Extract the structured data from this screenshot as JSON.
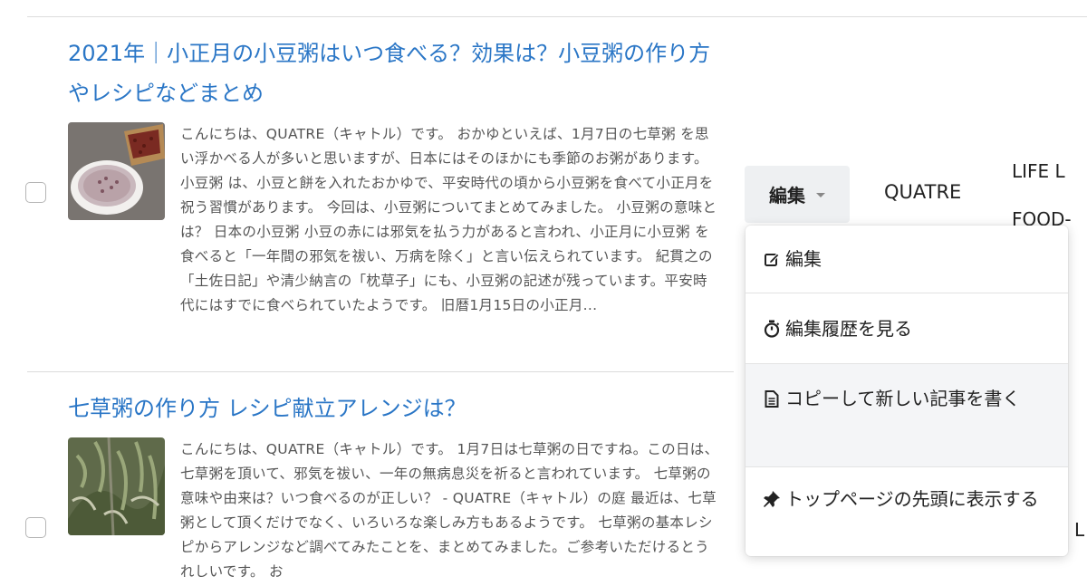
{
  "articles": [
    {
      "title": "2021年｜小正月の小豆粥はいつ食べる？効果は？小豆粥の作り方やレシピなどまとめ",
      "excerpt": "こんにちは、QUATRE（キャトル）です。 おかゆといえば、1月7日の七草粥 を思い浮かべる人が多いと思いますが、日本にはそのほかにも季節のお粥があります。 小豆粥 は、小豆と餅を入れたおかゆで、平安時代の頃から小豆粥を食べて小正月を祝う習慣があります。 今回は、小豆粥についてまとめてみました。 小豆粥の意味とは？ 日本の小豆粥 小豆の赤には邪気を払う力があると言われ、小正月に小豆粥 を食べると「一年間の邪気を祓い、万病を除く」と言い伝えられています。 紀貫之の「土佐日記」や清少納言の「枕草子」にも、小豆粥の記述が残っています。平安時代にはすでに食べられていたようです。 旧暦1月15日の小正月..."
    },
    {
      "title": "七草粥の作り方 レシピ献立アレンジは？",
      "excerpt": "こんにちは、QUATRE（キャトル）です。 1月7日は七草粥の日ですね。この日は、七草粥を頂いて、邪気を祓い、一年の無病息災を祈ると言われています。 七草粥の意味や由来は？いつ食べるのが正しい？ - QUATRE（キャトル）の庭 最近は、七草粥として頂くだけでなく、いろいろな楽しみ方もあるようです。 七草粥の基本レシピからアレンジなど調べてみたことを、まとめてみました。ご参考いただけるとうれしいです。 お"
    }
  ],
  "row_actions": {
    "edit_label": "編集",
    "author": "QUATRE",
    "categories_line1": "LIFE  L",
    "categories_line2": "FOOD-",
    "category_bottom": "L"
  },
  "dropdown": {
    "items": [
      {
        "label": "編集",
        "icon": "edit-icon"
      },
      {
        "label": "編集履歴を見る",
        "icon": "stopwatch-icon"
      },
      {
        "label": "コピーして新しい記事を書く",
        "icon": "document-icon"
      },
      {
        "label": "トップページの先頭に表示する",
        "icon": "pin-icon"
      }
    ]
  },
  "colors": {
    "link": "#2a76c6",
    "menu_hover": "#f4f5f7",
    "button_bg": "#eef0f2"
  }
}
